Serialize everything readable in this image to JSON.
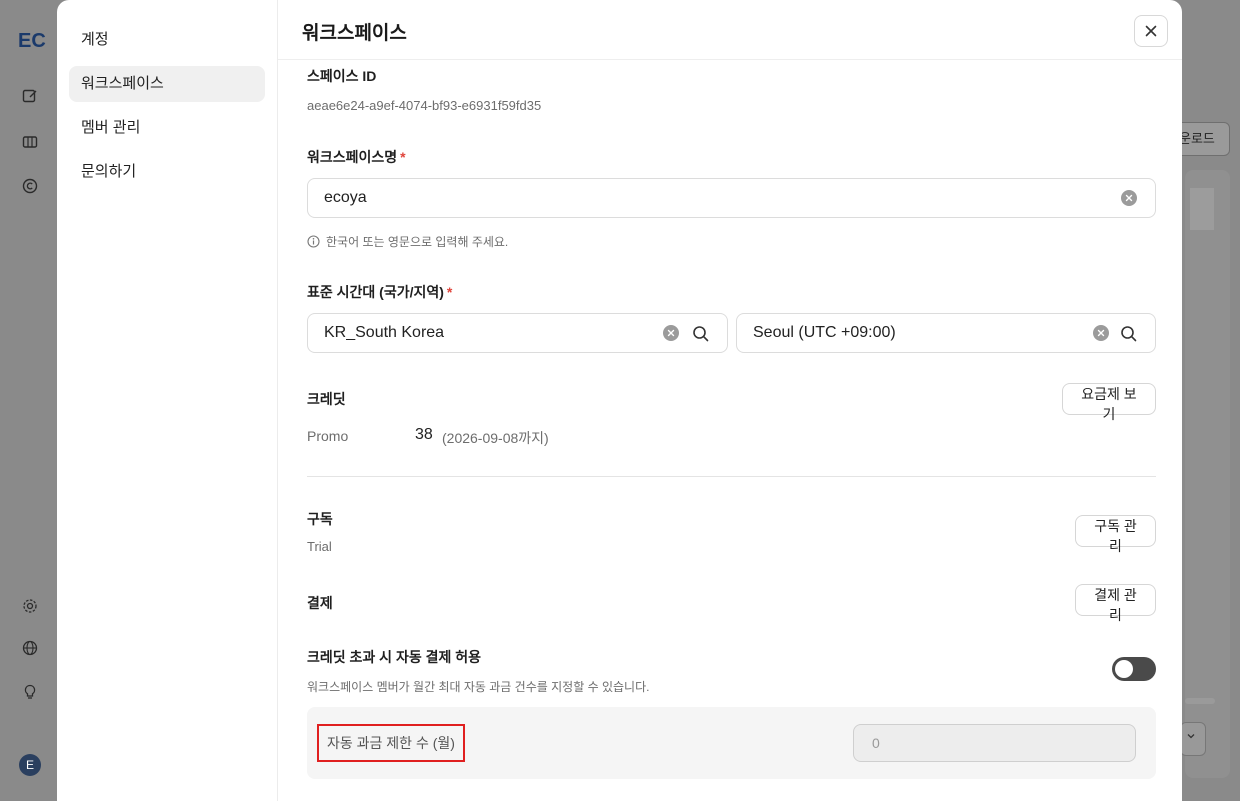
{
  "background": {
    "logo": "EC",
    "download_button": "운로드",
    "avatar_letter": "E"
  },
  "nav": {
    "items": [
      {
        "label": "계정"
      },
      {
        "label": "워크스페이스"
      },
      {
        "label": "멤버 관리"
      },
      {
        "label": "문의하기"
      }
    ],
    "active_index": 1
  },
  "header": {
    "title": "워크스페이스"
  },
  "space_id": {
    "label": "스페이스 ID",
    "value": "aeae6e24-a9ef-4074-bf93-e6931f59fd35"
  },
  "workspace_name": {
    "label": "워크스페이스명",
    "required_mark": "*",
    "value": "ecoya",
    "hint": "한국어 또는 영문으로 입력해 주세요."
  },
  "timezone": {
    "label": "표준 시간대 (국가/지역)",
    "required_mark": "*",
    "country_value": "KR_South Korea",
    "city_value": "Seoul (UTC +09:00)"
  },
  "credit": {
    "label": "크레딧",
    "plan_button": "요금제 보기",
    "type": "Promo",
    "amount": "38",
    "expiry": "(2026-09-08까지)"
  },
  "subscription": {
    "label": "구독",
    "status": "Trial",
    "manage_button": "구독 관리"
  },
  "payment": {
    "label": "결제",
    "manage_button": "결제 관리"
  },
  "auto_payment": {
    "label": "크레딧 초과 시 자동 결제 허용",
    "description": "워크스페이스 멤버가 월간 최대 자동 과금 건수를 지정할 수 있습니다.",
    "enabled": false,
    "limit_label": "자동 과금 제한 수 (월)",
    "limit_value": "0"
  },
  "colors": {
    "required": "#e0443b",
    "highlight": "#e02020",
    "toggle_off": "#4a4a4a"
  }
}
